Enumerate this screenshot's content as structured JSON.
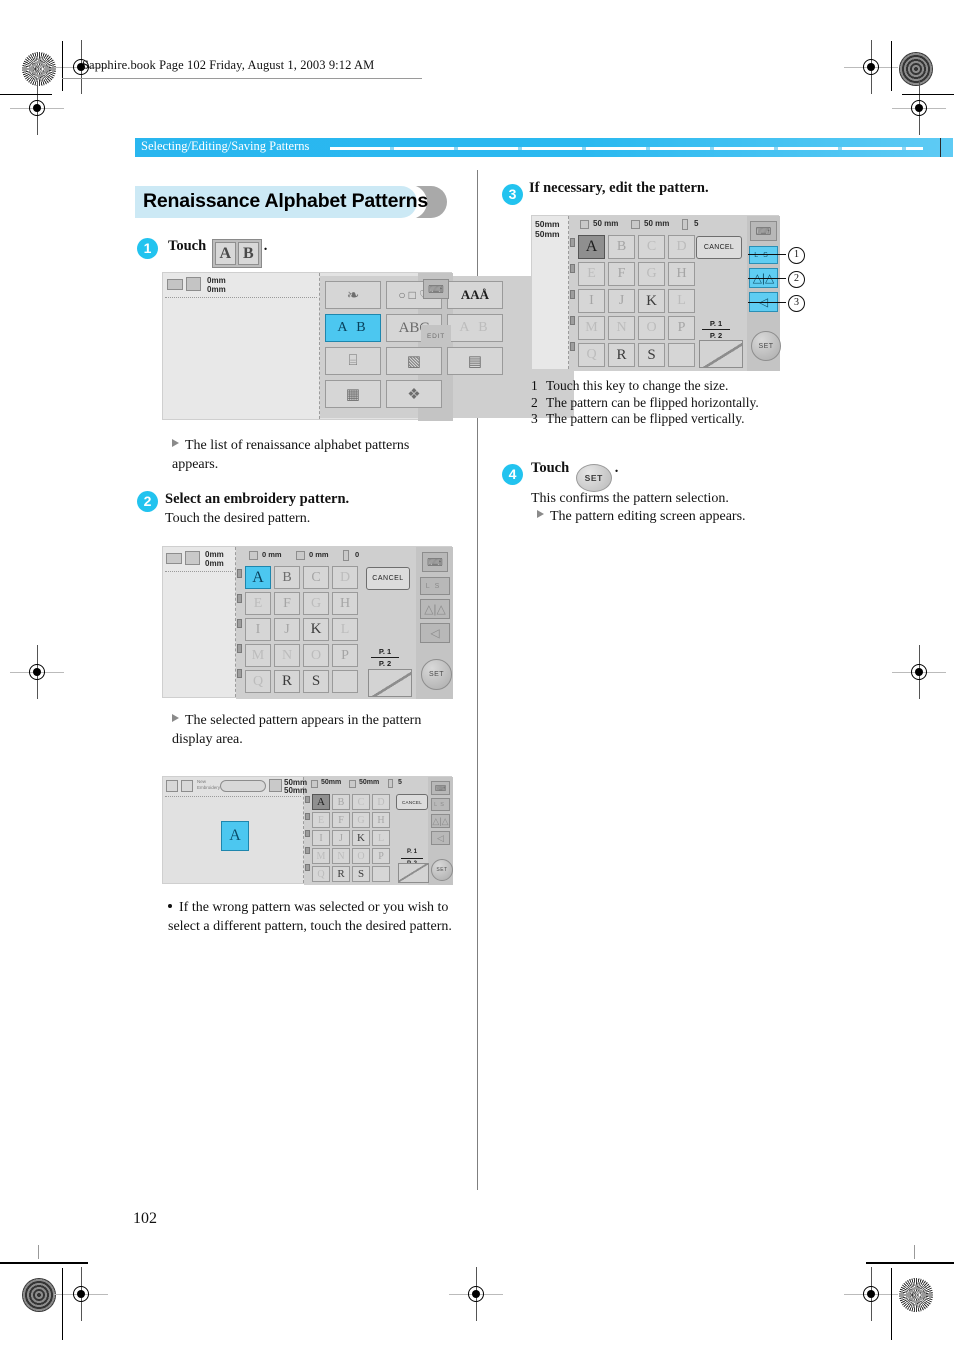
{
  "page": {
    "running_head": "Sapphire.book  Page 102  Friday, August 1, 2003  9:12 AM",
    "section_bar_label": "Selecting/Editing/Saving Patterns",
    "chapter_title": "Renaissance Alphabet Patterns",
    "page_number": "102",
    "accent_cyan": "#22c3ef",
    "bar_blue": "#29b6ef",
    "banner_pill": "#cce9f5"
  },
  "steps": {
    "one": {
      "number": "1",
      "label": "Touch",
      "key_glyphs": [
        "A",
        "B"
      ],
      "period": ".",
      "result": "The list of renaissance alphabet patterns appears."
    },
    "two": {
      "number": "2",
      "title": "Select an embroidery pattern.",
      "subtitle": "Touch the desired pattern.",
      "result": "The selected pattern appears in the pattern display area.",
      "note": "If the wrong pattern was selected or you wish to select a different pattern, touch the desired pattern."
    },
    "three": {
      "number": "3",
      "title": "If necessary, edit the pattern.",
      "callouts": [
        "1",
        "2",
        "3"
      ],
      "notes": [
        "Touch this key to change the size.",
        "The pattern can be flipped horizontally.",
        "The pattern can be flipped vertically."
      ]
    },
    "four": {
      "number": "4",
      "label": "Touch",
      "key_label": "SET",
      "period": ".",
      "line1": "This confirms the pattern selection.",
      "result": "The pattern editing screen appears."
    }
  },
  "screenshot_menu": {
    "name": "embroidery-category-menu",
    "status_left": [
      "0mm",
      "0mm"
    ],
    "tiles": [
      {
        "name": "animals-florals",
        "glyph": "❧"
      },
      {
        "name": "frames-shapes",
        "glyph": "○ □ ♡"
      },
      {
        "name": "lettering-fonts",
        "glyph": "AAÅ"
      },
      {
        "name": "renaissance-alphabet",
        "glyph": "A B",
        "selected": true
      },
      {
        "name": "script-alphabet",
        "glyph": "ABC"
      },
      {
        "name": "outline-alphabet",
        "glyph": "A B"
      },
      {
        "name": "quilting-sewing",
        "glyph": "⌸"
      },
      {
        "name": "card-patterns",
        "glyph": "▧"
      },
      {
        "name": "memory-save",
        "glyph": "▤"
      },
      {
        "name": "usb-computer",
        "glyph": "▦"
      },
      {
        "name": "designs-book",
        "glyph": "❖"
      }
    ],
    "help_label": "",
    "edit_label": "EDIT"
  },
  "screenshot_select": {
    "name": "pattern-selection-screen",
    "status_left": [
      "0mm",
      "0mm"
    ],
    "status_fields": [
      {
        "icon": "height-icon",
        "value": "0 mm"
      },
      {
        "icon": "width-icon",
        "value": "0 mm"
      },
      {
        "icon": "thread-icon",
        "value": "0"
      }
    ],
    "cancel_label": "CANCEL",
    "page_label_top": "P. 1",
    "page_label_bottom": "P. 2",
    "set_label": "SET",
    "size_label_l": "L",
    "size_label_s": "S",
    "letters": [
      [
        "A",
        "B",
        "C",
        "D"
      ],
      [
        "E",
        "F",
        "G",
        "H"
      ],
      [
        "I",
        "J",
        "K",
        "L"
      ],
      [
        "M",
        "N",
        "O",
        "P"
      ],
      [
        "Q",
        "R",
        "S",
        ""
      ]
    ],
    "selected": "A"
  },
  "screenshot_display": {
    "name": "pattern-display-screen",
    "status_left": [
      "50mm",
      "50mm"
    ],
    "status_fields": [
      {
        "icon": "height-icon",
        "value": "50mm"
      },
      {
        "icon": "width-icon",
        "value": "50mm"
      },
      {
        "icon": "thread-icon",
        "value": "5"
      }
    ],
    "toolbar_labels": [
      "New",
      "Embroidery"
    ],
    "cancel_label": "CANCEL",
    "page_label_top": "P. 1",
    "page_label_bottom": "P. 2",
    "set_label": "SET",
    "size_label_l": "L",
    "size_label_s": "S",
    "preview_glyph": "A"
  },
  "screenshot_edit": {
    "name": "pattern-edit-screen",
    "status_left": [
      "50mm",
      "50mm"
    ],
    "status_fields": [
      {
        "icon": "height-icon",
        "value": "50 mm"
      },
      {
        "icon": "width-icon",
        "value": "50 mm"
      },
      {
        "icon": "thread-icon",
        "value": "5"
      }
    ],
    "cancel_label": "CANCEL",
    "page_label_top": "P. 1",
    "page_label_bottom": "P. 2",
    "set_label": "SET",
    "size_label_l": "L",
    "size_label_s": "S",
    "selected": "A"
  }
}
